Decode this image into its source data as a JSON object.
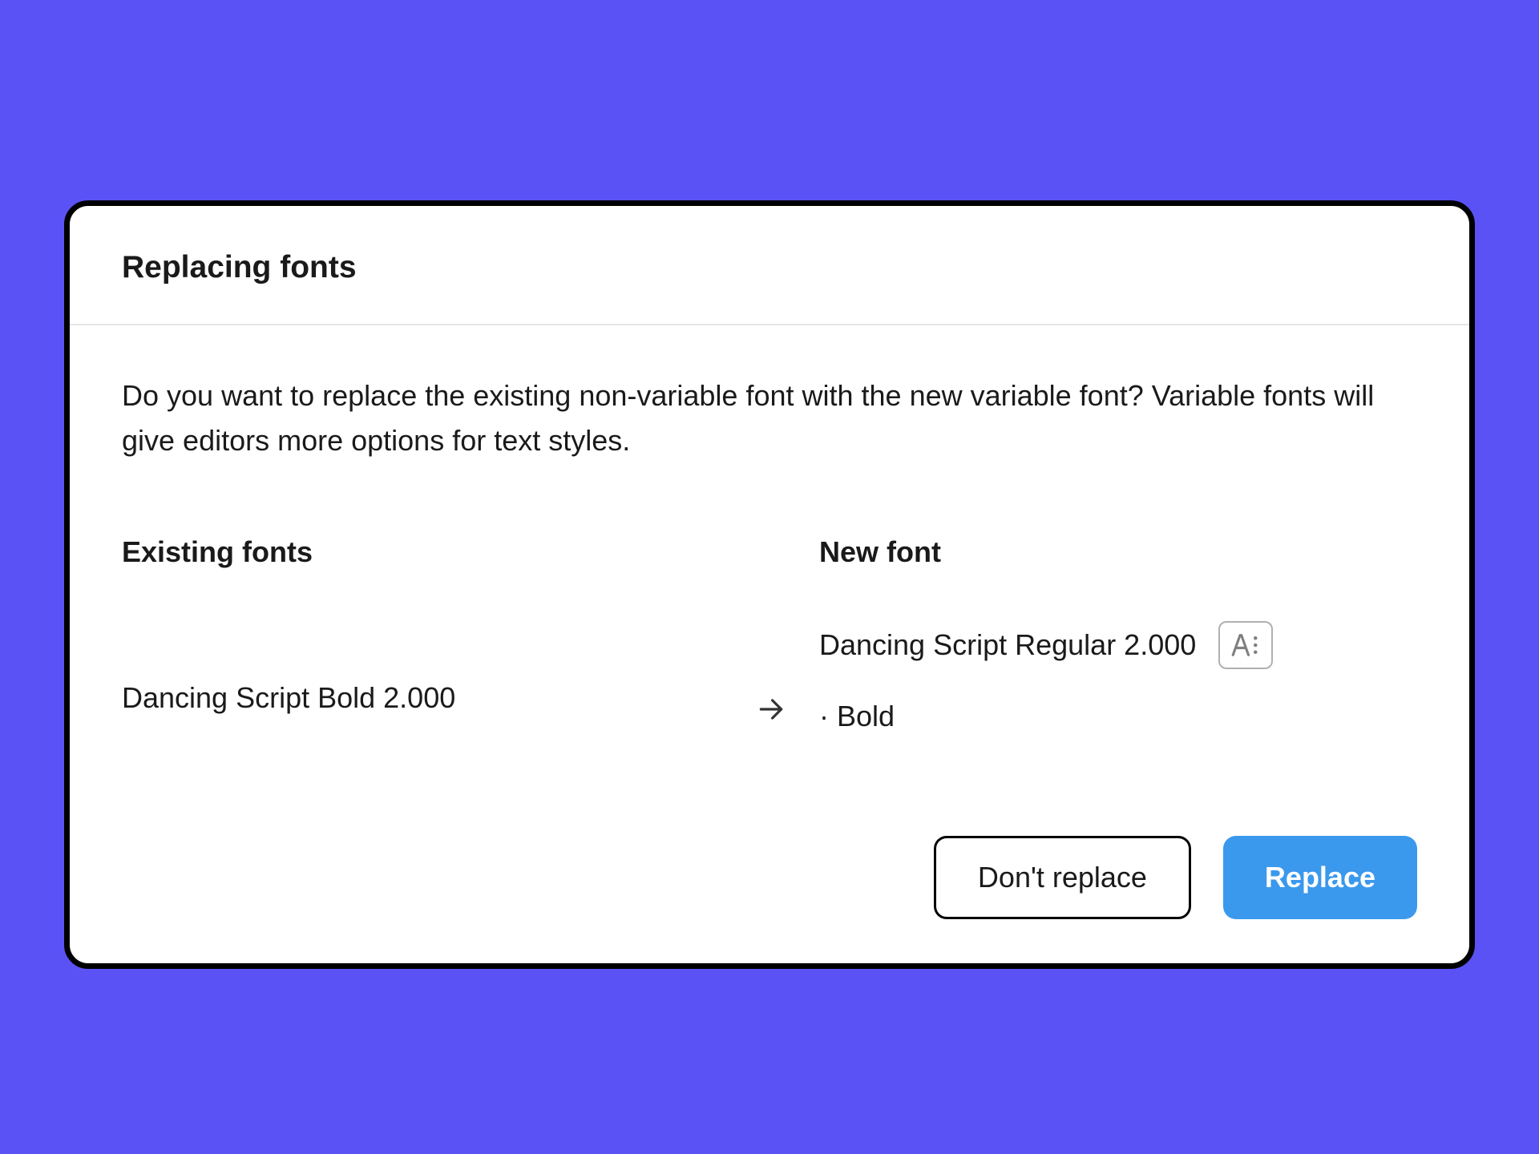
{
  "dialog": {
    "title": "Replacing fonts",
    "description": "Do you want to replace the existing non-variable font with the new variable font? Variable fonts will give editors more options for text styles.",
    "existing_heading": "Existing fonts",
    "new_heading": "New font",
    "existing_font": "Dancing Script Bold 2.000",
    "new_font_name": "Dancing Script Regular 2.000",
    "new_font_style": "·  Bold",
    "buttons": {
      "secondary": "Don't replace",
      "primary": "Replace"
    }
  }
}
